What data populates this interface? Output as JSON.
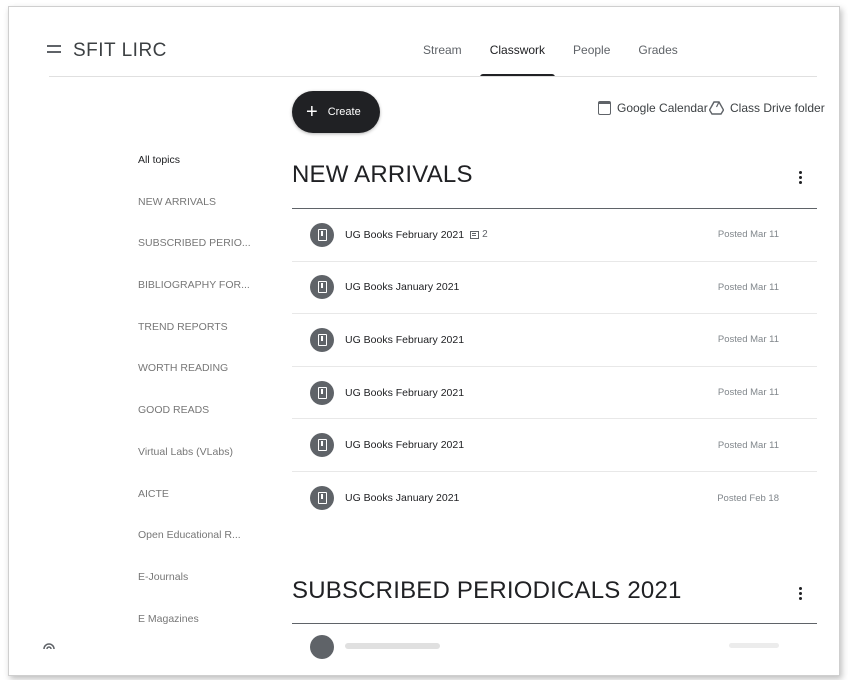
{
  "header": {
    "class_title": "SFIT LIRC",
    "tabs": [
      {
        "label": "Stream"
      },
      {
        "label": "Classwork"
      },
      {
        "label": "People"
      },
      {
        "label": "Grades"
      }
    ],
    "active_tab": "Classwork"
  },
  "toolbar": {
    "create_label": "Create",
    "calendar_label": "Google Calendar",
    "drive_label": "Class Drive folder"
  },
  "sidebar": {
    "topics": [
      {
        "label": "All topics"
      },
      {
        "label": "NEW ARRIVALS"
      },
      {
        "label": "SUBSCRIBED PERIO..."
      },
      {
        "label": "BIBLIOGRAPHY FOR..."
      },
      {
        "label": "TREND REPORTS"
      },
      {
        "label": "WORTH READING"
      },
      {
        "label": "GOOD READS"
      },
      {
        "label": "Virtual Labs (VLabs)"
      },
      {
        "label": "AICTE"
      },
      {
        "label": "Open Educational R..."
      },
      {
        "label": "E-Journals"
      },
      {
        "label": "E Magazines"
      }
    ]
  },
  "sections": [
    {
      "title": "NEW ARRIVALS",
      "posts": [
        {
          "title": "UG Books February 2021",
          "comments": "2",
          "date": "Posted Mar 11"
        },
        {
          "title": "UG Books January 2021",
          "date": "Posted Mar 11"
        },
        {
          "title": "UG Books February 2021",
          "date": "Posted Mar 11"
        },
        {
          "title": "UG Books February 2021",
          "date": "Posted Mar 11"
        },
        {
          "title": "UG Books February 2021",
          "date": "Posted Mar 11"
        },
        {
          "title": "UG Books January 2021",
          "date": "Posted Feb 18"
        }
      ]
    },
    {
      "title": "SUBSCRIBED PERIODICALS 2021"
    }
  ],
  "icons": {
    "menu": "menu-icon",
    "calendar": "calendar-icon",
    "drive": "drive-icon",
    "post": "book-icon",
    "comment": "comment-icon",
    "more": "more-vert-icon"
  }
}
